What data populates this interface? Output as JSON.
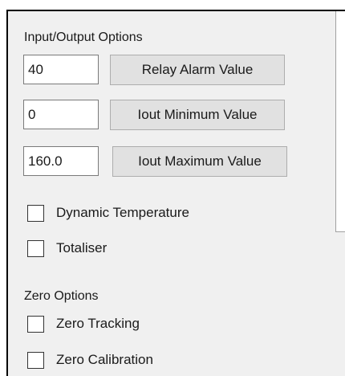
{
  "io_options": {
    "title": "Input/Output Options",
    "rows": [
      {
        "value": "40",
        "button_label": "Relay Alarm Value"
      },
      {
        "value": "0",
        "button_label": "Iout Minimum Value"
      },
      {
        "value": "160.0",
        "button_label": "Iout Maximum Value"
      }
    ],
    "checkboxes": [
      {
        "label": "Dynamic Temperature",
        "checked": false
      },
      {
        "label": "Totaliser",
        "checked": false
      }
    ]
  },
  "zero_options": {
    "title": "Zero Options",
    "checkboxes": [
      {
        "label": "Zero Tracking",
        "checked": false
      },
      {
        "label": "Zero Calibration",
        "checked": false
      }
    ]
  }
}
